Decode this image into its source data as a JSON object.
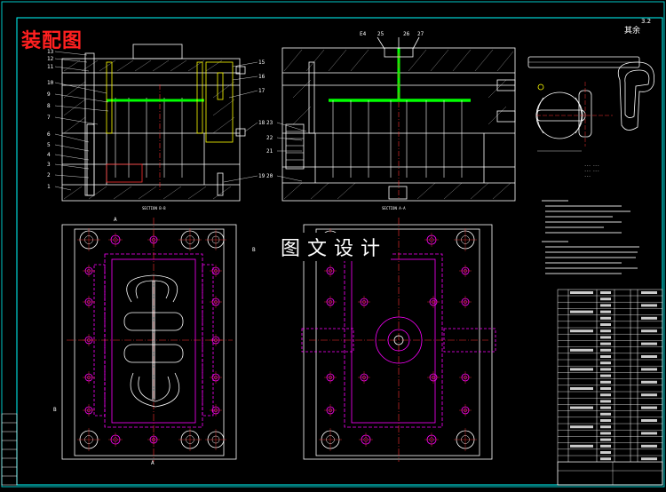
{
  "drawing": {
    "title": "装配图",
    "watermark": "图文设计",
    "scale_label": "其余",
    "roughness": "3.2",
    "part_numbers_left": [
      "13",
      "12",
      "11",
      "10",
      "9",
      "8",
      "7",
      "6",
      "5",
      "4",
      "3",
      "2",
      "1"
    ],
    "part_numbers_mid_right": [
      "15",
      "16",
      "17",
      "18",
      "19"
    ],
    "part_numbers_right": [
      "20",
      "21",
      "22",
      "23",
      "24"
    ],
    "top_labels": [
      "E4",
      "25",
      "26",
      "27"
    ],
    "section_b": "B",
    "section_a": "A",
    "colors": {
      "background": "#000000",
      "frame": "#00ffff",
      "line": "#ffffff",
      "red_title": "#ff2020",
      "magenta": "#ff00ff",
      "green": "#00ff00",
      "yellow": "#ffff00",
      "red_center": "#ff3030"
    }
  }
}
